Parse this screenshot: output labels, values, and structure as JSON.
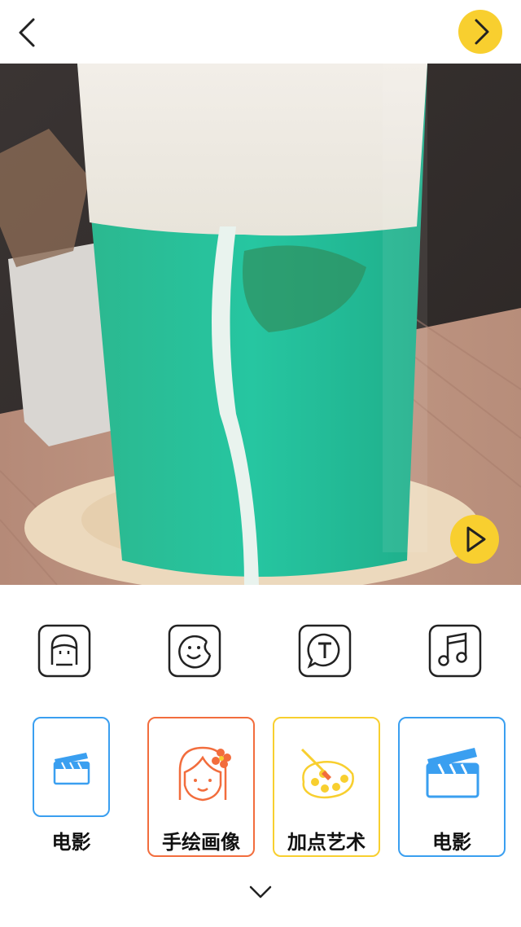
{
  "header": {
    "back_icon": "chevron-left-icon",
    "next_icon": "chevron-right-icon",
    "accent_color": "#f8cf2f"
  },
  "preview": {
    "subject": "photo-drink-glass",
    "play_icon": "play-icon"
  },
  "tools": [
    {
      "icon": "face-portrait-icon"
    },
    {
      "icon": "sticker-icon"
    },
    {
      "icon": "text-bubble-icon"
    },
    {
      "icon": "music-note-icon"
    }
  ],
  "effects": [
    {
      "label": "电影",
      "icon": "clapperboard-icon",
      "border_color": "#3a9ff0"
    },
    {
      "label": "手绘画像",
      "icon": "girl-portrait-icon",
      "border_color": "#f26d3d"
    },
    {
      "label": "加点艺术",
      "icon": "palette-icon",
      "border_color": "#f8cf2f"
    },
    {
      "label": "电影",
      "icon": "clapperboard-icon",
      "border_color": "#3a9ff0"
    }
  ],
  "footer": {
    "collapse_icon": "chevron-down-icon"
  }
}
